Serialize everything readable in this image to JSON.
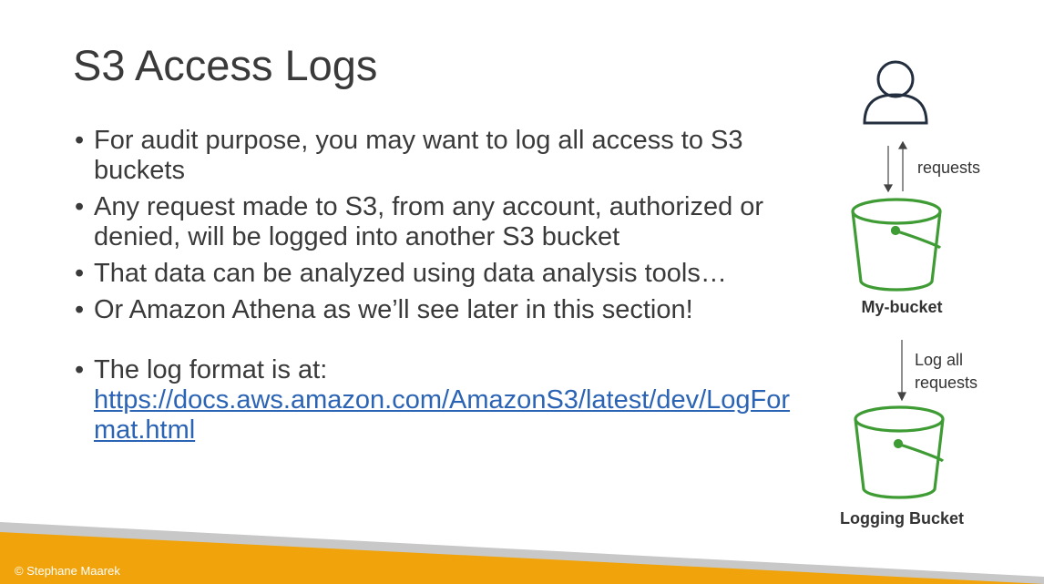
{
  "slide": {
    "title": "S3 Access Logs",
    "bullets": [
      "For audit purpose, you may want to log all access to S3 buckets",
      "Any request made to S3, from any account, authorized or denied, will be logged into another S3 bucket",
      "That data can be analyzed using data analysis tools…",
      "Or Amazon Athena as we’ll see later in this section!"
    ],
    "log_format_text": "The log format is at:",
    "log_format_link": "https://docs.aws.amazon.com/AmazonS3/latest/dev/LogFormat.html"
  },
  "diagram": {
    "user_icon": "user-icon",
    "requests_label": "requests",
    "bucket_icon": "s3-bucket-icon",
    "source_bucket_label": "My-bucket",
    "log_arrow_line1": "Log all",
    "log_arrow_line2": "requests",
    "target_bucket_label": "Logging Bucket"
  },
  "footer": {
    "copyright": "© Stephane Maarek"
  },
  "colors": {
    "bucket_green": "#3f9c35",
    "link_blue": "#2b63b5",
    "footer_orange": "#f0a30a",
    "footer_gray": "#c8c8c8"
  }
}
